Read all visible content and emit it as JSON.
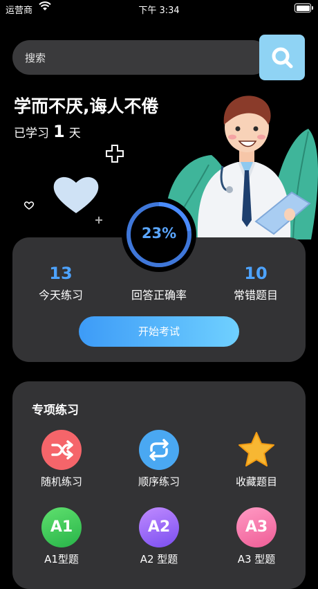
{
  "status_bar": {
    "carrier": "运营商",
    "time": "下午 3:34"
  },
  "search": {
    "placeholder": "搜索"
  },
  "hero": {
    "headline": "学而不厌,诲人不倦",
    "studied_prefix": "已学习",
    "studied_days": "1",
    "studied_suffix": "天"
  },
  "progress": {
    "percent_label": "23%",
    "percent": 0.23,
    "color": "#4a8cff"
  },
  "stats": [
    {
      "value": "13",
      "label": "今天练习"
    },
    {
      "label": "回答正确率"
    },
    {
      "value": "10",
      "label": "常错题目"
    }
  ],
  "start_button": {
    "label": "开始考试"
  },
  "special": {
    "title": "专项练习",
    "items": [
      {
        "label": "随机练习",
        "icon": "shuffle-icon",
        "color": "#f5656a"
      },
      {
        "label": "顺序练习",
        "icon": "repeat-icon",
        "color": "#4aa8f2"
      },
      {
        "label": "收藏题目",
        "icon": "star-icon",
        "color": "#f7b733"
      },
      {
        "label": "A1型题",
        "badge": "A1",
        "icon": "a1-badge-icon",
        "color": "#3cc75a"
      },
      {
        "label": "A2 型题",
        "badge": "A2",
        "icon": "a2-badge-icon",
        "color": "#9a6cf5"
      },
      {
        "label": "A3 型题",
        "badge": "A3",
        "icon": "a3-badge-icon",
        "color": "#f575a8"
      }
    ]
  }
}
